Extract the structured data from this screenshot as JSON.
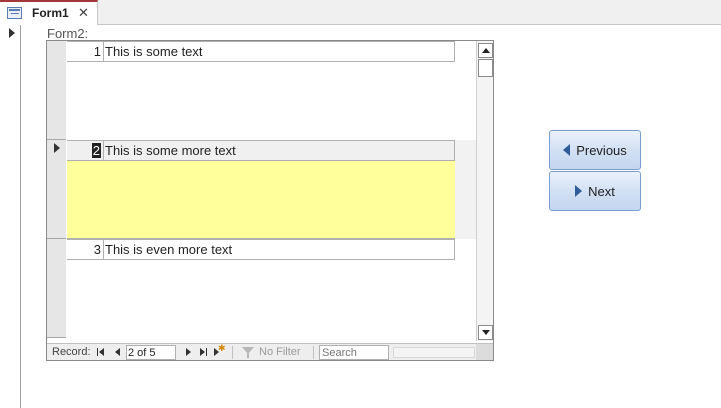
{
  "document_tab": {
    "label": "Form1",
    "close_glyph": "✕",
    "icon": "form-icon"
  },
  "subform": {
    "label": "Form2:",
    "current_record_index": 1,
    "records": [
      {
        "id": "1",
        "text": "This is some text"
      },
      {
        "id": "2",
        "text": "This is some more text"
      },
      {
        "id": "3",
        "text": "This is even more text"
      }
    ],
    "highlight_color": "#ffff9b"
  },
  "navigation": {
    "record_label": "Record:",
    "current": "2 of 5",
    "filter_label": "No Filter",
    "search_placeholder": "Search"
  },
  "buttons": {
    "previous_label": "Previous",
    "next_label": "Next",
    "accent_color": "#2f5d99"
  }
}
